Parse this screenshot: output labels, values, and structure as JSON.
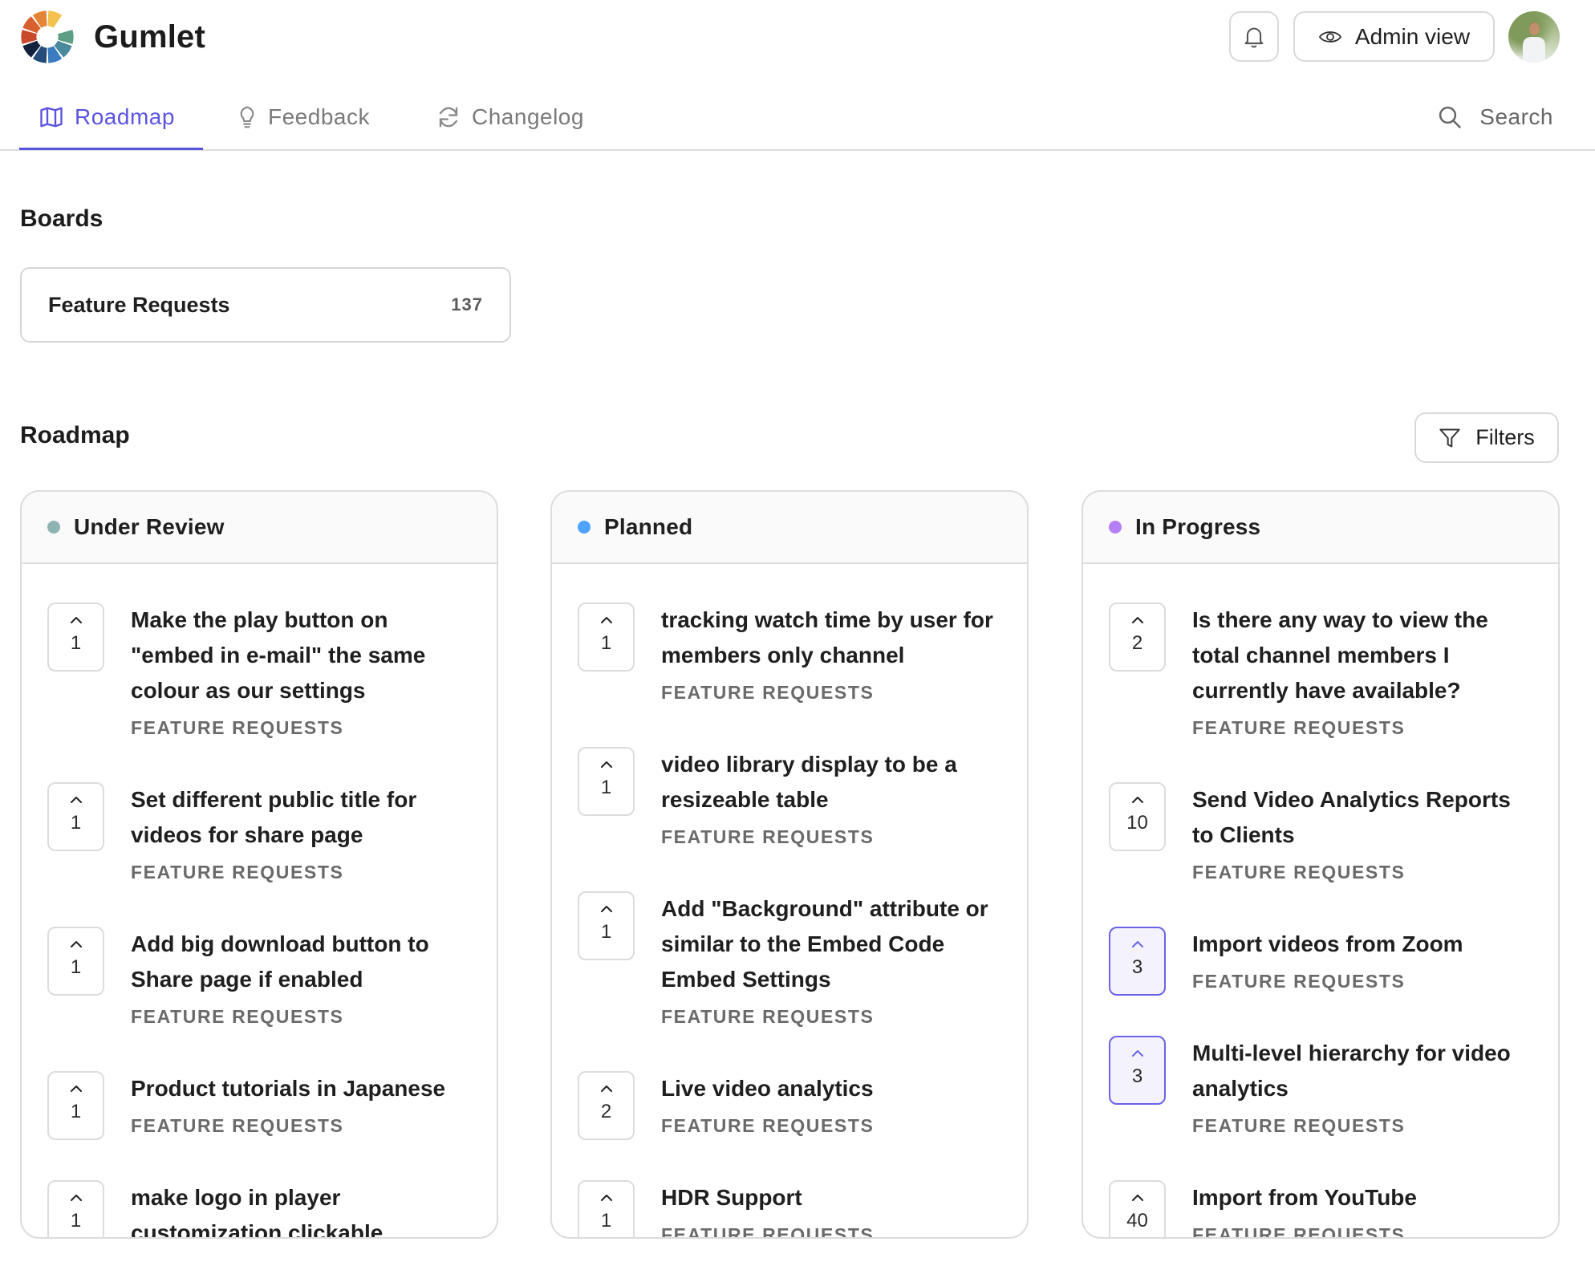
{
  "app": {
    "brand": "Gumlet",
    "admin_view_label": "Admin view",
    "icons": {
      "notifications": "bell-icon",
      "admin": "eye-icon",
      "search": "search-icon",
      "filters": "filter-icon",
      "upvote": "chevron-up-icon"
    }
  },
  "nav": {
    "tabs": [
      {
        "label": "Roadmap",
        "icon": "map-icon",
        "active": true
      },
      {
        "label": "Feedback",
        "icon": "lightbulb-icon",
        "active": false
      },
      {
        "label": "Changelog",
        "icon": "refresh-icon",
        "active": false
      }
    ],
    "search_label": "Search"
  },
  "colors": {
    "accent": "#5b54e0",
    "under_review": "#8fb3b3",
    "planned": "#4da3ff",
    "in_progress": "#b57ff5"
  },
  "boards": {
    "title": "Boards",
    "items": [
      {
        "name": "Feature Requests",
        "count": "137"
      }
    ]
  },
  "roadmap": {
    "title": "Roadmap",
    "filters_label": "Filters",
    "columns": [
      {
        "title": "Under Review",
        "items": [
          {
            "votes": "1",
            "title": "Make the play button on \"embed in e-mail\" the same colour as our settings",
            "category": "FEATURE REQUESTS",
            "voted": false
          },
          {
            "votes": "1",
            "title": "Set different public title for videos for share page",
            "category": "FEATURE REQUESTS",
            "voted": false
          },
          {
            "votes": "1",
            "title": "Add big download button to Share page if enabled",
            "category": "FEATURE REQUESTS",
            "voted": false
          },
          {
            "votes": "1",
            "title": "Product tutorials in Japanese",
            "category": "FEATURE REQUESTS",
            "voted": false
          },
          {
            "votes": "1",
            "title": "make logo in player customization clickable",
            "category": "",
            "voted": false
          }
        ]
      },
      {
        "title": "Planned",
        "items": [
          {
            "votes": "1",
            "title": "tracking watch time by user for members only channel",
            "category": "FEATURE REQUESTS",
            "voted": false
          },
          {
            "votes": "1",
            "title": "video library display to be a resizeable table",
            "category": "FEATURE REQUESTS",
            "voted": false
          },
          {
            "votes": "1",
            "title": "Add \"Background\" attribute or similar to the Embed Code Embed Settings",
            "category": "FEATURE REQUESTS",
            "voted": false
          },
          {
            "votes": "2",
            "title": "Live video analytics",
            "category": "FEATURE REQUESTS",
            "voted": false
          },
          {
            "votes": "1",
            "title": "HDR Support",
            "category": "FEATURE REQUESTS",
            "voted": false
          }
        ]
      },
      {
        "title": "In Progress",
        "items": [
          {
            "votes": "2",
            "title": "Is there any way to view the total channel members I currently have available?",
            "category": "FEATURE REQUESTS",
            "voted": false
          },
          {
            "votes": "10",
            "title": "Send Video Analytics Reports to Clients",
            "category": "FEATURE REQUESTS",
            "voted": false
          },
          {
            "votes": "3",
            "title": "Import videos from Zoom",
            "category": "FEATURE REQUESTS",
            "voted": true
          },
          {
            "votes": "3",
            "title": "Multi-level hierarchy for video analytics",
            "category": "FEATURE REQUESTS",
            "voted": true
          },
          {
            "votes": "40",
            "title": "Import from YouTube",
            "category": "FEATURE REQUESTS",
            "voted": false
          }
        ]
      }
    ]
  }
}
